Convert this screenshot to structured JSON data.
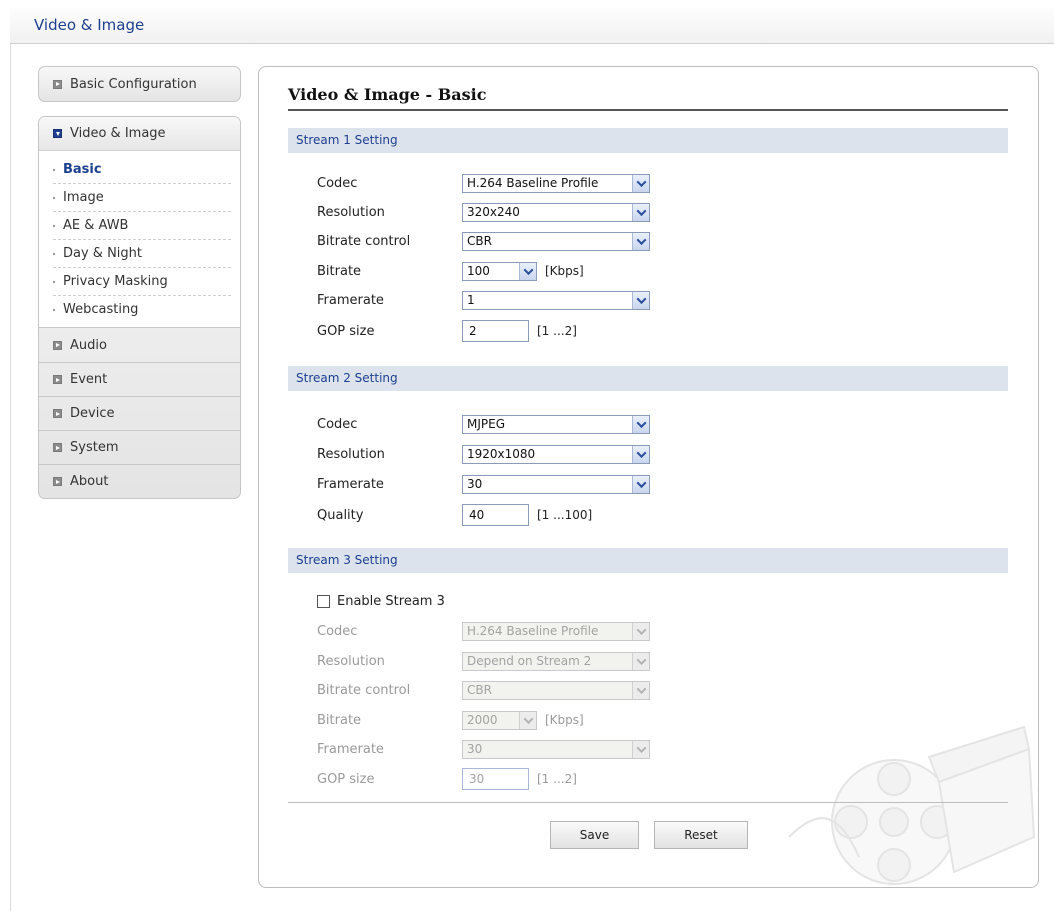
{
  "header": {
    "title": "Video & Image"
  },
  "sidebar": {
    "top_item": {
      "label": "Basic Configuration",
      "icon": "expand-closed-icon"
    },
    "active_group": {
      "label": "Video & Image",
      "icon": "expand-open-icon",
      "subitems": [
        "Basic",
        "Image",
        "AE & AWB",
        "Day & Night",
        "Privacy Masking",
        "Webcasting"
      ],
      "active_index": 0
    },
    "items": [
      "Audio",
      "Event",
      "Device",
      "System",
      "About"
    ]
  },
  "main": {
    "title": "Video & Image - Basic",
    "stream1": {
      "heading": "Stream 1 Setting",
      "codec_label": "Codec",
      "codec": "H.264 Baseline Profile",
      "resolution_label": "Resolution",
      "resolution": "320x240",
      "bitrate_control_label": "Bitrate control",
      "bitrate_control": "CBR",
      "bitrate_label": "Bitrate",
      "bitrate": "100",
      "bitrate_unit": "[Kbps]",
      "framerate_label": "Framerate",
      "framerate": "1",
      "gop_label": "GOP size",
      "gop": "2",
      "gop_range": "[1 ...2]"
    },
    "stream2": {
      "heading": "Stream 2 Setting",
      "codec_label": "Codec",
      "codec": "MJPEG",
      "resolution_label": "Resolution",
      "resolution": "1920x1080",
      "framerate_label": "Framerate",
      "framerate": "30",
      "quality_label": "Quality",
      "quality": "40",
      "quality_range": "[1 ...100]"
    },
    "stream3": {
      "heading": "Stream 3 Setting",
      "enable_label": "Enable Stream 3",
      "enabled": false,
      "codec_label": "Codec",
      "codec": "H.264 Baseline Profile",
      "resolution_label": "Resolution",
      "resolution": "Depend on Stream 2",
      "bitrate_control_label": "Bitrate control",
      "bitrate_control": "CBR",
      "bitrate_label": "Bitrate",
      "bitrate": "2000",
      "bitrate_unit": "[Kbps]",
      "framerate_label": "Framerate",
      "framerate": "30",
      "gop_label": "GOP size",
      "gop": "30",
      "gop_range": "[1 ...2]"
    },
    "buttons": {
      "save": "Save",
      "reset": "Reset"
    }
  },
  "colors": {
    "accent": "#1d3f8f",
    "section_bg": "#dde3ed",
    "disabled_text": "#9a9a9a"
  }
}
